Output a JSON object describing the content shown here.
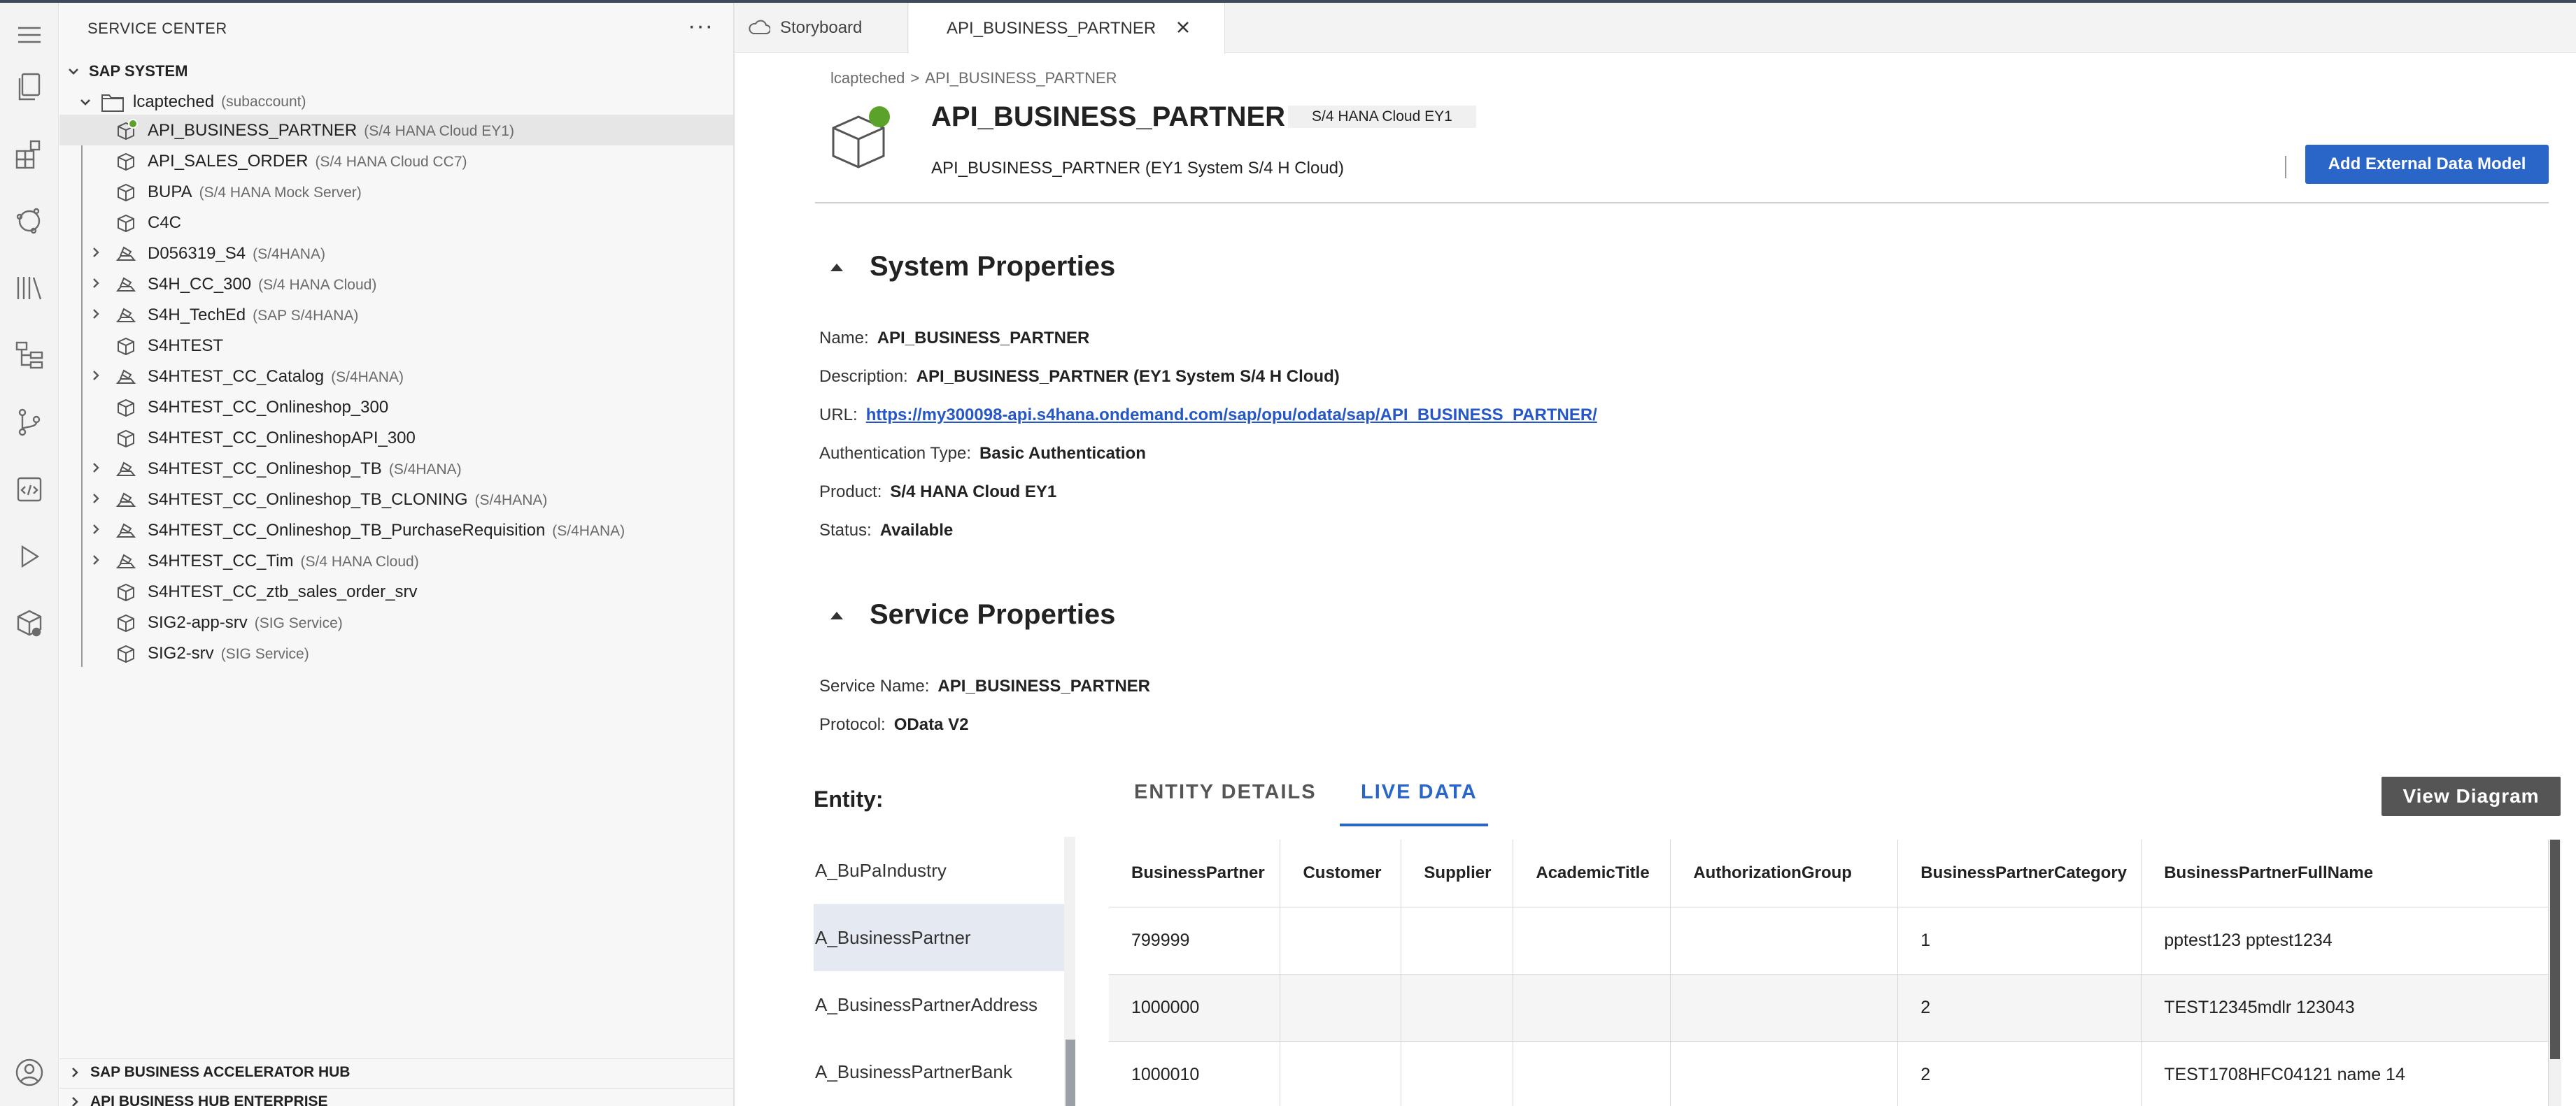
{
  "sidebar": {
    "title": "SERVICE CENTER",
    "more": "···",
    "root": "SAP SYSTEM",
    "subaccount": {
      "name": "lcapteched",
      "tag": "(subaccount)"
    },
    "items": [
      {
        "name": "API_BUSINESS_PARTNER",
        "tag": "(S/4 HANA Cloud EY1)",
        "icon": "box-icon",
        "expandable": false,
        "selected": true,
        "active_dot": true
      },
      {
        "name": "API_SALES_ORDER",
        "tag": "(S/4 HANA Cloud CC7)",
        "icon": "box-icon",
        "expandable": false
      },
      {
        "name": "BUPA",
        "tag": "(S/4 HANA Mock Server)",
        "icon": "box-icon",
        "expandable": false
      },
      {
        "name": "C4C",
        "tag": "",
        "icon": "box-icon",
        "expandable": false
      },
      {
        "name": "D056319_S4",
        "tag": "(S/4HANA)",
        "icon": "stack-icon",
        "expandable": true
      },
      {
        "name": "S4H_CC_300",
        "tag": "(S/4 HANA Cloud)",
        "icon": "stack-icon",
        "expandable": true
      },
      {
        "name": "S4H_TechEd",
        "tag": "(SAP S/4HANA)",
        "icon": "stack-icon",
        "expandable": true
      },
      {
        "name": "S4HTEST",
        "tag": "",
        "icon": "box-icon",
        "expandable": false
      },
      {
        "name": "S4HTEST_CC_Catalog",
        "tag": "(S/4HANA)",
        "icon": "stack-icon",
        "expandable": true
      },
      {
        "name": "S4HTEST_CC_Onlineshop_300",
        "tag": "",
        "icon": "box-icon",
        "expandable": false
      },
      {
        "name": "S4HTEST_CC_OnlineshopAPI_300",
        "tag": "",
        "icon": "box-icon",
        "expandable": false
      },
      {
        "name": "S4HTEST_CC_Onlineshop_TB",
        "tag": "(S/4HANA)",
        "icon": "stack-icon",
        "expandable": true
      },
      {
        "name": "S4HTEST_CC_Onlineshop_TB_CLONING",
        "tag": "(S/4HANA)",
        "icon": "stack-icon",
        "expandable": true
      },
      {
        "name": "S4HTEST_CC_Onlineshop_TB_PurchaseRequisition",
        "tag": "(S/4HANA)",
        "icon": "stack-icon",
        "expandable": true
      },
      {
        "name": "S4HTEST_CC_Tim",
        "tag": "(S/4 HANA Cloud)",
        "icon": "stack-icon",
        "expandable": true
      },
      {
        "name": "S4HTEST_CC_ztb_sales_order_srv",
        "tag": "",
        "icon": "box-icon",
        "expandable": false
      },
      {
        "name": "SIG2-app-srv",
        "tag": "(SIG Service)",
        "icon": "box-icon",
        "expandable": false
      },
      {
        "name": "SIG2-srv",
        "tag": "(SIG Service)",
        "icon": "box-icon",
        "expandable": false
      }
    ],
    "bottom_sections": [
      "SAP BUSINESS ACCELERATOR HUB",
      "API BUSINESS HUB ENTERPRISE"
    ]
  },
  "tabs": [
    {
      "label": "Storyboard",
      "icon": "cloud-icon"
    },
    {
      "label": "API_BUSINESS_PARTNER",
      "active": true
    }
  ],
  "header": {
    "breadcrumb": [
      "lcapteched",
      "API_BUSINESS_PARTNER"
    ],
    "breadcrumb_sep": ">",
    "title": "API_BUSINESS_PARTNER",
    "badge": "S/4 HANA Cloud EY1",
    "description": "API_BUSINESS_PARTNER (EY1 System S/4 H Cloud)",
    "add_button": "Add External Data Model"
  },
  "system_properties": {
    "title": "System Properties",
    "rows": [
      {
        "label": "Name:",
        "value": "API_BUSINESS_PARTNER"
      },
      {
        "label": "Description:",
        "value": "API_BUSINESS_PARTNER (EY1 System S/4 H Cloud)"
      },
      {
        "label": "URL:",
        "value": "https://my300098-api.s4hana.ondemand.com/sap/opu/odata/sap/API_BUSINESS_PARTNER/"
      },
      {
        "label": "Authentication Type:",
        "value": "Basic Authentication"
      },
      {
        "label": "Product:",
        "value": "S/4 HANA Cloud EY1"
      },
      {
        "label": "Status:",
        "value": "Available"
      }
    ]
  },
  "service_properties": {
    "title": "Service Properties",
    "rows": [
      {
        "label": "Service Name:",
        "value": "API_BUSINESS_PARTNER"
      },
      {
        "label": "Protocol:",
        "value": "OData V2"
      }
    ]
  },
  "entity": {
    "label": "Entity:",
    "items": [
      "A_BuPaIndustry",
      "A_BusinessPartner",
      "A_BusinessPartnerAddress",
      "A_BusinessPartnerBank"
    ],
    "selected_index": 1
  },
  "detail_tabs": [
    "ENTITY DETAILS",
    "LIVE DATA"
  ],
  "active_detail_tab": "LIVE DATA",
  "view_diagram": "View Diagram",
  "table": {
    "columns": [
      "BusinessPartner",
      "Customer",
      "Supplier",
      "AcademicTitle",
      "AuthorizationGroup",
      "BusinessPartnerCategory",
      "BusinessPartnerFullName"
    ],
    "rows": [
      [
        "799999",
        "",
        "",
        "",
        "",
        "1",
        "pptest123 pptest1234"
      ],
      [
        "1000000",
        "",
        "",
        "",
        "",
        "2",
        "TEST12345mdlr 123043"
      ],
      [
        "1000010",
        "",
        "",
        "",
        "",
        "2",
        "TEST1708HFC04121 name 14"
      ]
    ]
  },
  "colors": {
    "accent": "#2a65c8",
    "status_green": "#5aa22a",
    "link": "#2657c9"
  }
}
